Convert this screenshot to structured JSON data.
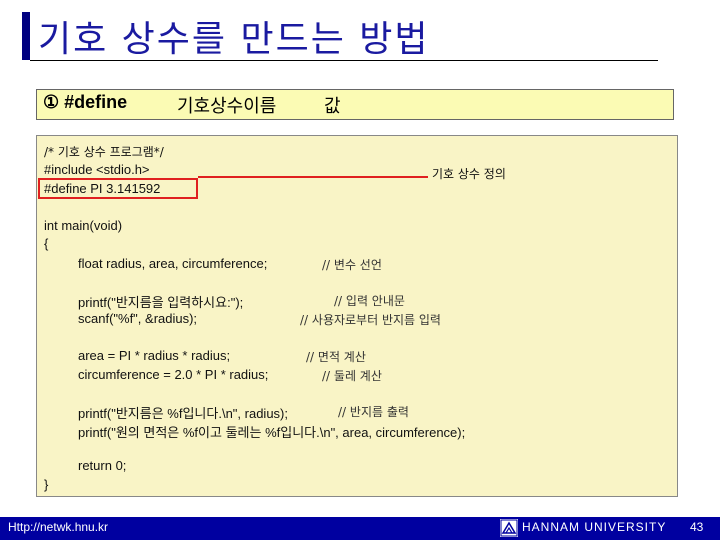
{
  "slide": {
    "title": "기호 상수를 만드는 방법"
  },
  "syntax": {
    "define": "① #define",
    "name": "기호상수이름",
    "value": "값"
  },
  "code": {
    "line1": "/* 기호 상수 프로그램*/",
    "line2": "#include <stdio.h>",
    "line3": "#define PI 3.141592",
    "line4": "int main(void)",
    "line5": "{",
    "line6": "float radius, area, circumference;",
    "line7": "printf(\"반지름을 입력하시요:\");",
    "line8": "scanf(\"%f\", &radius);",
    "line9": "area = PI * radius * radius;",
    "line10": "circumference = 2.0 * PI * radius;",
    "line11": "printf(\"반지름은 %f입니다.\\n\", radius);",
    "line12": "printf(\"원의 면적은 %f이고 둘레는 %f입니다.\\n\", area, circumference);",
    "line13": "return 0;",
    "line14": "}"
  },
  "comments": {
    "c1": "// 변수 선언",
    "c2": "// 입력 안내문",
    "c3": "// 사용자로부터 반지름 입력",
    "c4": "// 면적 계산",
    "c5": "// 둘레 계산",
    "c6": "// 반지름 출력"
  },
  "annotation": {
    "label": "기호 상수 정의",
    "color": "#e02020"
  },
  "footer": {
    "url": "Http://netwk.hnu.kr",
    "university": "HANNAM UNIVERSITY",
    "page": "43",
    "bar_color": "#0000a0"
  }
}
